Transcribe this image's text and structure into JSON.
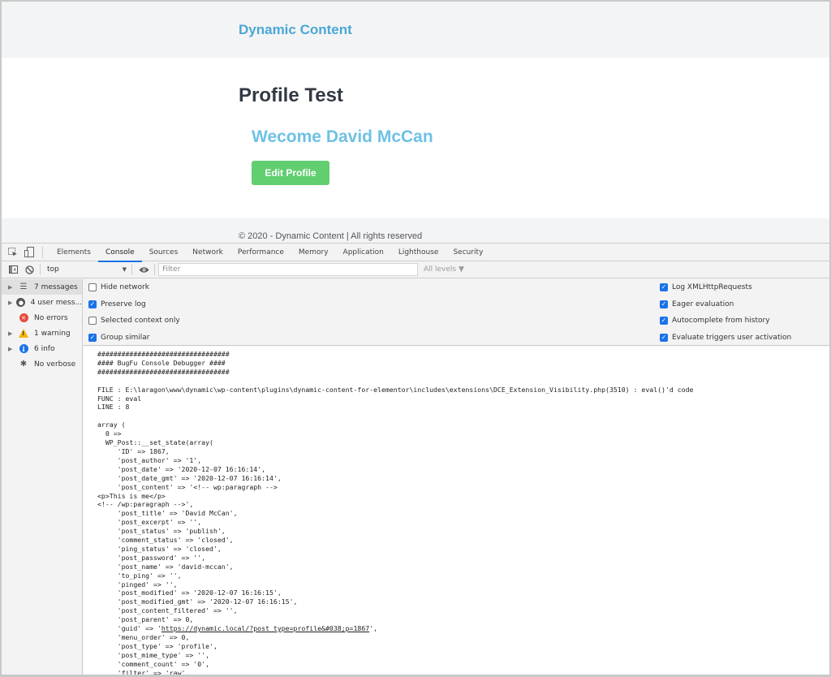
{
  "site": {
    "brand": "Dynamic Content",
    "page_title": "Profile Test",
    "welcome": "Wecome David McCan",
    "edit_button": "Edit Profile",
    "footer": "© 2020 - Dynamic Content | All rights reserved",
    "colors": {
      "brand": "#4aa7d4",
      "welcome": "#6ec1e4",
      "button": "#61ce70"
    }
  },
  "devtools": {
    "tabs": [
      {
        "label": "Elements",
        "active": false
      },
      {
        "label": "Console",
        "active": true
      },
      {
        "label": "Sources",
        "active": false
      },
      {
        "label": "Network",
        "active": false
      },
      {
        "label": "Performance",
        "active": false
      },
      {
        "label": "Memory",
        "active": false
      },
      {
        "label": "Application",
        "active": false
      },
      {
        "label": "Lighthouse",
        "active": false
      },
      {
        "label": "Security",
        "active": false
      }
    ],
    "toolbar": {
      "context": "top",
      "filter_placeholder": "Filter",
      "filter_value": "",
      "levels": "All levels ▼"
    },
    "sidebar": [
      {
        "label": "7 messages",
        "icon": "list-icon",
        "expandable": true
      },
      {
        "label": "4 user mess...",
        "icon": "user-icon",
        "expandable": true
      },
      {
        "label": "No errors",
        "icon": "error-icon",
        "expandable": false
      },
      {
        "label": "1 warning",
        "icon": "warning-icon",
        "expandable": true
      },
      {
        "label": "6 info",
        "icon": "info-icon",
        "expandable": true
      },
      {
        "label": "No verbose",
        "icon": "bug-icon",
        "expandable": false
      }
    ],
    "settings_left": [
      {
        "label": "Hide network",
        "checked": false
      },
      {
        "label": "Preserve log",
        "checked": true
      },
      {
        "label": "Selected context only",
        "checked": false
      },
      {
        "label": "Group similar",
        "checked": true
      }
    ],
    "settings_right": [
      {
        "label": "Log XMLHttpRequests",
        "checked": true
      },
      {
        "label": "Eager evaluation",
        "checked": true
      },
      {
        "label": "Autocomplete from history",
        "checked": true
      },
      {
        "label": "Evaluate triggers user activation",
        "checked": true
      }
    ],
    "console_lines": [
      "#################################",
      "#### BugFu Console Debugger ####",
      "#################################",
      "",
      "FILE : E:\\laragon\\www\\dynamic\\wp-content\\plugins\\dynamic-content-for-elementor\\includes\\extensions\\DCE_Extension_Visibility.php(3510) : eval()'d code",
      "FUNC : eval",
      "LINE : 8",
      "",
      "array (",
      "  0 =>",
      "  WP_Post::__set_state(array(",
      "     'ID' => 1867,",
      "     'post_author' => '1',",
      "     'post_date' => '2020-12-07 16:16:14',",
      "     'post_date_gmt' => '2020-12-07 16:16:14',",
      "     'post_content' => '<!-- wp:paragraph -->",
      "<p>This is me</p>",
      "<!-- /wp:paragraph -->',",
      "     'post_title' => 'David McCan',",
      "     'post_excerpt' => '',",
      "     'post_status' => 'publish',",
      "     'comment_status' => 'closed',",
      "     'ping_status' => 'closed',",
      "     'post_password' => '',",
      "     'post_name' => 'david-mccan',",
      "     'to_ping' => '',",
      "     'pinged' => '',",
      "     'post_modified' => '2020-12-07 16:16:15',",
      "     'post_modified_gmt' => '2020-12-07 16:16:15',",
      "     'post_content_filtered' => '',",
      "     'post_parent' => 0,",
      "     'guid' => 'https://dynamic.local/?post_type=profile&#038;p=1867',",
      "     'menu_order' => 0,",
      "     'post_type' => 'profile',",
      "     'post_mime_type' => '',",
      "     'comment_count' => '0',",
      "     'filter' => 'raw',"
    ],
    "guid_link": "https://dynamic.local/?post_type=profile&#038;p=1867"
  }
}
